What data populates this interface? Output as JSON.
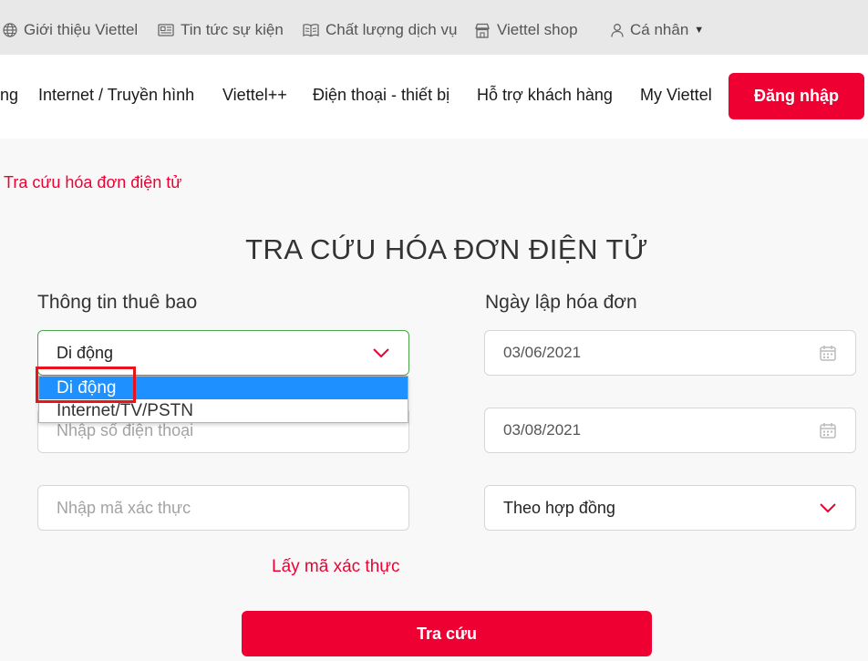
{
  "topbar": {
    "items": [
      {
        "label": "Giới thiệu Viettel",
        "icon": "globe-icon"
      },
      {
        "label": "Tin tức sự kiện",
        "icon": "newspaper-icon"
      },
      {
        "label": "Chất lượng dịch vụ",
        "icon": "book-icon"
      },
      {
        "label": "Viettel shop",
        "icon": "store-icon"
      },
      {
        "label": "Cá nhân",
        "icon": "user-icon"
      }
    ]
  },
  "nav": {
    "items": [
      "ng",
      "Internet / Truyền hình",
      "Viettel++",
      "Điện thoại - thiết bị",
      "Hỗ trợ khách hàng",
      "My Viettel"
    ],
    "login_label": "Đăng nhập"
  },
  "breadcrumb": "Tra cứu hóa đơn điện tử",
  "page_title": "TRA CỨU HÓA ĐƠN ĐIỆN TỬ",
  "form": {
    "subscriber_label": "Thông tin thuê bao",
    "date_label": "Ngày lập hóa đơn",
    "service_type": {
      "value": "Di động",
      "options": [
        "Di động",
        "Internet/TV/PSTN"
      ],
      "selected_index": 0
    },
    "phone_placeholder": "Nhập số điện thoại",
    "otp_placeholder": "Nhập mã xác thực",
    "date_from": "03/06/2021",
    "date_to": "03/08/2021",
    "lookup_by": "Theo hợp đồng",
    "get_otp_label": "Lấy mã xác thực",
    "submit_label": "Tra cứu"
  },
  "colors": {
    "accent": "#ee0033",
    "focus_border": "#4aa34a",
    "selected_option": "#1e90ff"
  }
}
